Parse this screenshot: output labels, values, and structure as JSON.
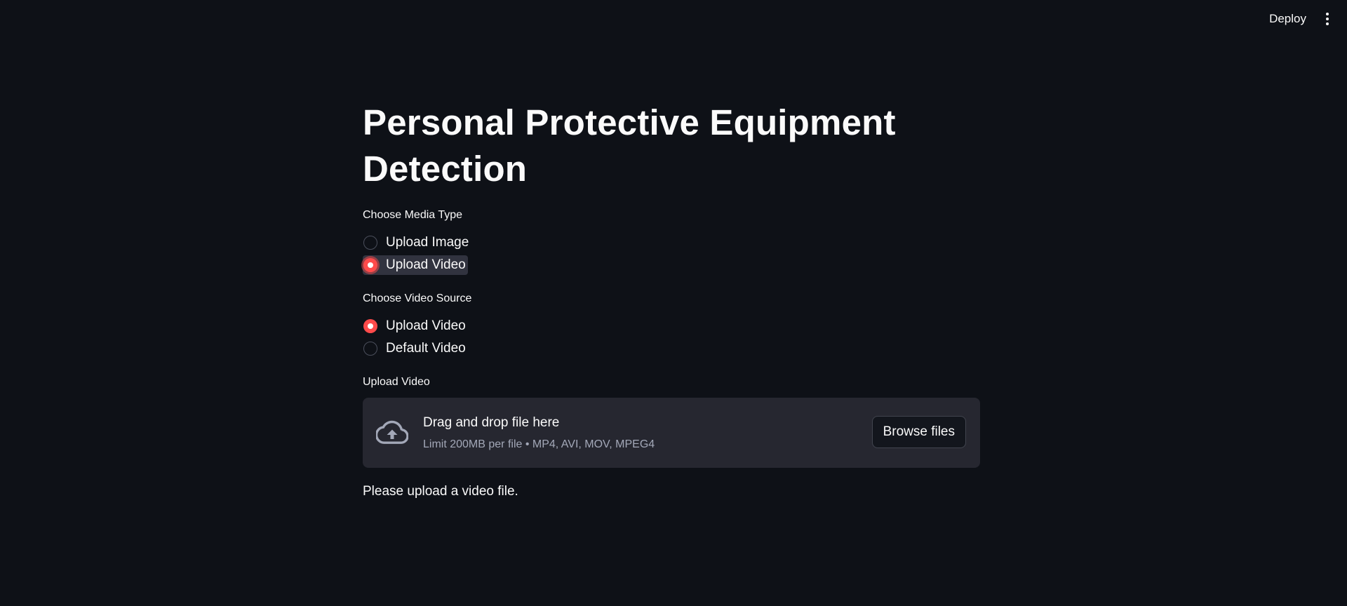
{
  "header": {
    "deploy_label": "Deploy",
    "menu_icon": "kebab-menu-icon"
  },
  "main": {
    "title": "Personal Protective Equipment Detection",
    "media_type": {
      "label": "Choose Media Type",
      "options": [
        "Upload Image",
        "Upload Video"
      ],
      "selected": "Upload Video"
    },
    "video_source": {
      "label": "Choose Video Source",
      "options": [
        "Upload Video",
        "Default Video"
      ],
      "selected": "Upload Video"
    },
    "uploader": {
      "label": "Upload Video",
      "icon": "cloud-upload-icon",
      "drop_title": "Drag and drop file here",
      "drop_limit": "Limit 200MB per file • MP4, AVI, MOV, MPEG4",
      "browse_label": "Browse files"
    },
    "info_text": "Please upload a video file."
  },
  "colors": {
    "background": "#0e1117",
    "accent": "#ff4b4b",
    "uploader_bg": "#262730",
    "muted_text": "#a3a8b8"
  }
}
